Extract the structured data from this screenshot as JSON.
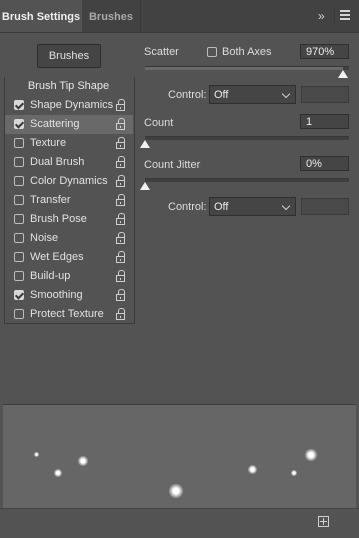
{
  "tabs": [
    {
      "label": "Brush Settings",
      "active": true
    },
    {
      "label": "Brushes",
      "active": false
    }
  ],
  "header": {
    "collapse_icon": "double-chevron-right-icon",
    "menu_icon": "panel-menu-icon",
    "collapse_glyph": "»"
  },
  "brushes_button": "Brushes",
  "options": {
    "header": "Brush Tip Shape",
    "items": [
      {
        "label": "Shape Dynamics",
        "checked": true,
        "selected": false
      },
      {
        "label": "Scattering",
        "checked": true,
        "selected": true
      },
      {
        "label": "Texture",
        "checked": false,
        "selected": false
      },
      {
        "label": "Dual Brush",
        "checked": false,
        "selected": false
      },
      {
        "label": "Color Dynamics",
        "checked": false,
        "selected": false
      },
      {
        "label": "Transfer",
        "checked": false,
        "selected": false
      },
      {
        "label": "Brush Pose",
        "checked": false,
        "selected": false
      },
      {
        "label": "Noise",
        "checked": false,
        "selected": false
      },
      {
        "label": "Wet Edges",
        "checked": false,
        "selected": false
      },
      {
        "label": "Build-up",
        "checked": false,
        "selected": false
      },
      {
        "label": "Smoothing",
        "checked": true,
        "selected": false
      },
      {
        "label": "Protect Texture",
        "checked": false,
        "selected": false
      }
    ]
  },
  "scattering": {
    "scatter_label": "Scatter",
    "both_axes_label": "Both Axes",
    "both_axes_checked": false,
    "scatter_value": "970%",
    "scatter_fraction": 0.97,
    "control1_label": "Control:",
    "control1_value": "Off",
    "count_label": "Count",
    "count_value": "1",
    "count_fraction": 0.0,
    "count_jitter_label": "Count Jitter",
    "count_jitter_value": "0%",
    "count_jitter_fraction": 0.0,
    "control2_label": "Control:",
    "control2_value": "Off"
  },
  "footer": {
    "new_preset_icon": "new-brush-preset-icon"
  }
}
